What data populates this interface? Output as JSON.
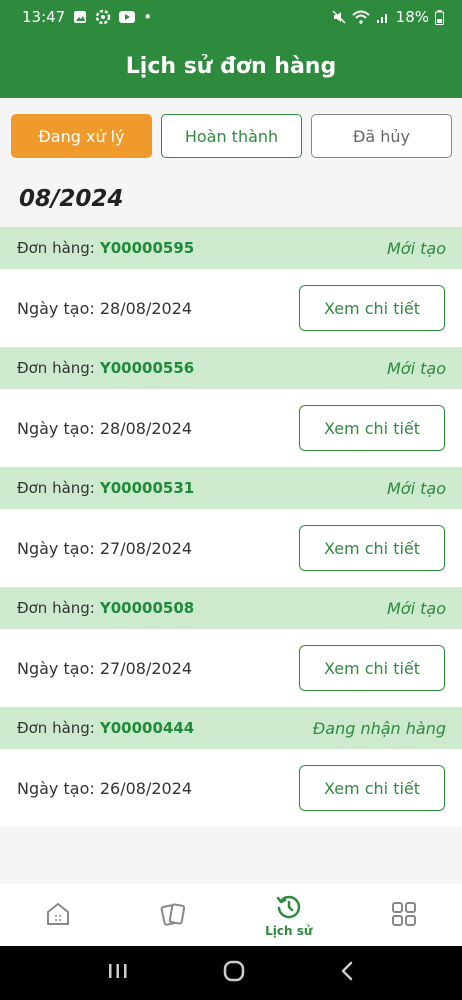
{
  "status_bar": {
    "time": "13:47",
    "battery": "18%",
    "dot": "•"
  },
  "header": {
    "title": "Lịch sử đơn hàng"
  },
  "tabs": [
    {
      "label": "Đang xử lý",
      "active": true
    },
    {
      "label": "Hoàn thành",
      "active": false
    },
    {
      "label": "Đã hủy",
      "active": false
    }
  ],
  "month_label": "08/2024",
  "orders": [
    {
      "prefix": "Đơn hàng:",
      "code": "Y00000595",
      "status": "Mới tạo",
      "date": "Ngày tạo: 28/08/2024",
      "action": "Xem chi tiết"
    },
    {
      "prefix": "Đơn hàng:",
      "code": "Y00000556",
      "status": "Mới tạo",
      "date": "Ngày tạo: 28/08/2024",
      "action": "Xem chi tiết"
    },
    {
      "prefix": "Đơn hàng:",
      "code": "Y00000531",
      "status": "Mới tạo",
      "date": "Ngày tạo: 27/08/2024",
      "action": "Xem chi tiết"
    },
    {
      "prefix": "Đơn hàng:",
      "code": "Y00000508",
      "status": "Mới tạo",
      "date": "Ngày tạo: 27/08/2024",
      "action": "Xem chi tiết"
    },
    {
      "prefix": "Đơn hàng:",
      "code": "Y00000444",
      "status": "Đang nhận hàng",
      "date": "Ngày tạo: 26/08/2024",
      "action": "Xem chi tiết"
    }
  ],
  "bottom_nav": [
    {
      "icon": "home-icon",
      "label": ""
    },
    {
      "icon": "cards-icon",
      "label": ""
    },
    {
      "icon": "history-icon",
      "label": "Lịch sử"
    },
    {
      "icon": "grid-icon",
      "label": ""
    }
  ],
  "colors": {
    "primary": "#2e8b3e",
    "accent": "#ef9a2a",
    "row_head": "#cdeacf"
  }
}
